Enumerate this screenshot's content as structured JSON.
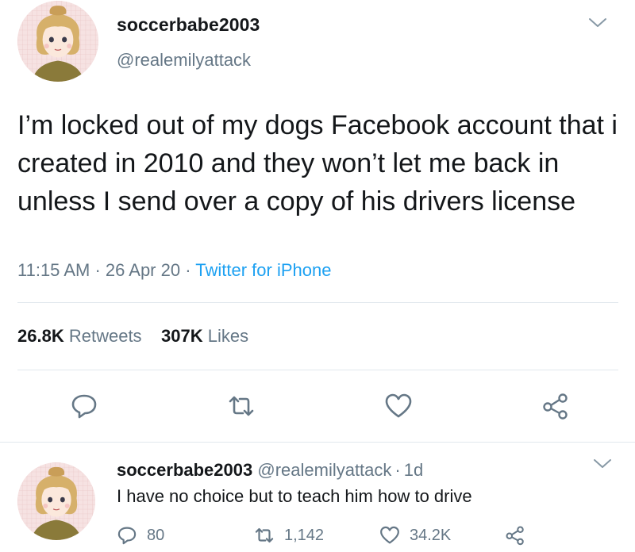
{
  "tweet": {
    "display_name": "soccerbabe2003",
    "handle": "@realemilyattack",
    "text": "I’m locked out of my dogs Facebook account that i created in 2010 and they won’t let me back in unless I send over a copy of his drivers license",
    "time": "11:15 AM",
    "date": "26 Apr 20",
    "separator": "·",
    "source": "Twitter for iPhone",
    "retweets_count": "26.8K",
    "retweets_label": "Retweets",
    "likes_count": "307K",
    "likes_label": "Likes"
  },
  "reply": {
    "display_name": "soccerbabe2003",
    "handle": "@realemilyattack",
    "age": "1d",
    "text": "I have no choice but to teach him how to drive",
    "replies": "80",
    "retweets": "1,142",
    "likes": "34.2K"
  },
  "icons": {
    "caret": "chevron-down-icon",
    "reply": "comment-icon",
    "retweet": "retweet-icon",
    "like": "heart-icon",
    "share": "share-icon"
  },
  "colors": {
    "accent": "#1da1f2",
    "secondary_text": "#657786",
    "divider": "#e1e8ed",
    "avatar_bg": "#f6e4e4"
  }
}
